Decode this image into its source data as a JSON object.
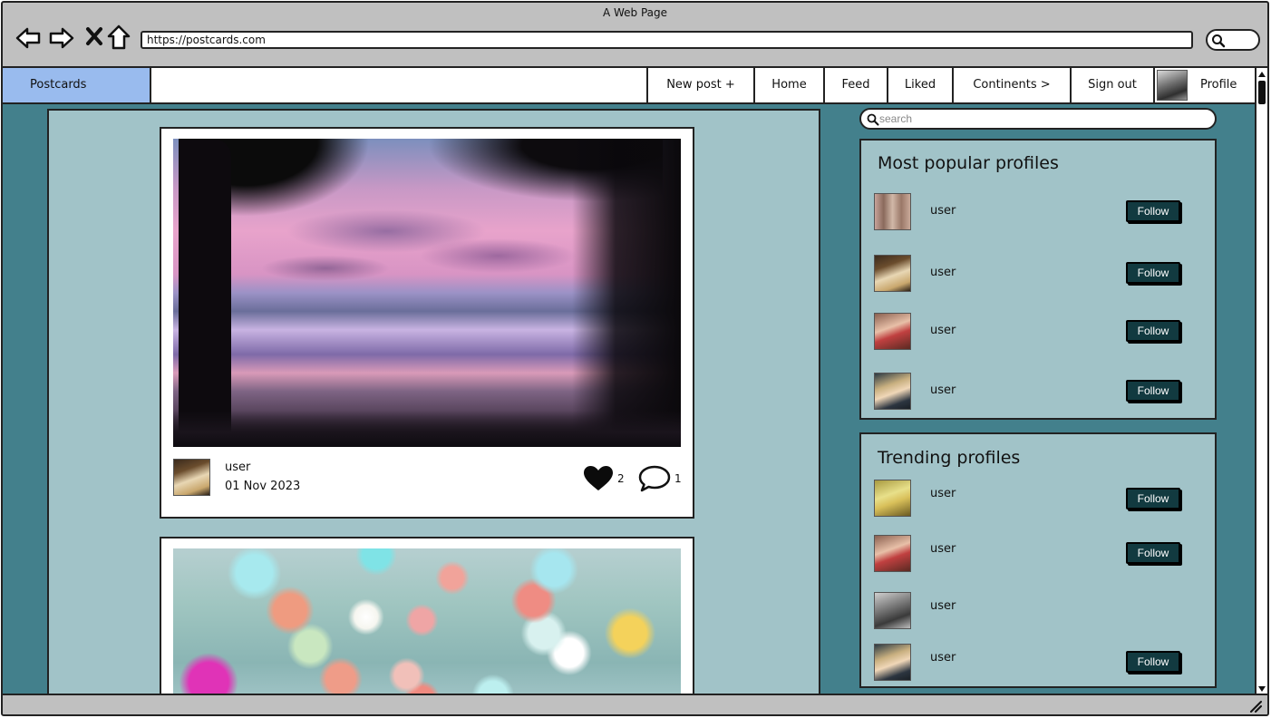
{
  "browser": {
    "title": "A Web Page",
    "url": "https://postcards.com",
    "nav_icons": [
      "back-arrow-icon",
      "forward-arrow-icon",
      "close-x-icon",
      "home-icon"
    ],
    "search_icon": "search-icon"
  },
  "app": {
    "brand": "Postcards",
    "nav": {
      "new_post": "New post +",
      "home": "Home",
      "feed": "Feed",
      "liked": "Liked",
      "continents": "Continents >",
      "sign_out": "Sign out",
      "profile": "Profile"
    }
  },
  "feed": {
    "posts": [
      {
        "image": "sunset-beach-photo",
        "user": "user",
        "date": "01 Nov 2023",
        "likes": "2",
        "comments": "1"
      },
      {
        "image": "bokeh-lights-photo"
      }
    ]
  },
  "sidebar": {
    "search_placeholder": "search",
    "popular": {
      "title": "Most popular profiles",
      "profiles": [
        {
          "name": "user",
          "follow_label": "Follow"
        },
        {
          "name": "user",
          "follow_label": "Follow"
        },
        {
          "name": "user",
          "follow_label": "Follow"
        },
        {
          "name": "user",
          "follow_label": "Follow"
        }
      ]
    },
    "trending": {
      "title": "Trending profiles",
      "profiles": [
        {
          "name": "user",
          "follow_label": "Follow"
        },
        {
          "name": "user",
          "follow_label": "Follow"
        },
        {
          "name": "user"
        },
        {
          "name": "user",
          "follow_label": "Follow"
        }
      ]
    }
  },
  "colors": {
    "page_background": "#43808c",
    "panel_background": "#a1c3c8",
    "brand_background": "#99bbee",
    "follow_button": "#123a40",
    "browser_chrome": "#c0c0c0"
  }
}
